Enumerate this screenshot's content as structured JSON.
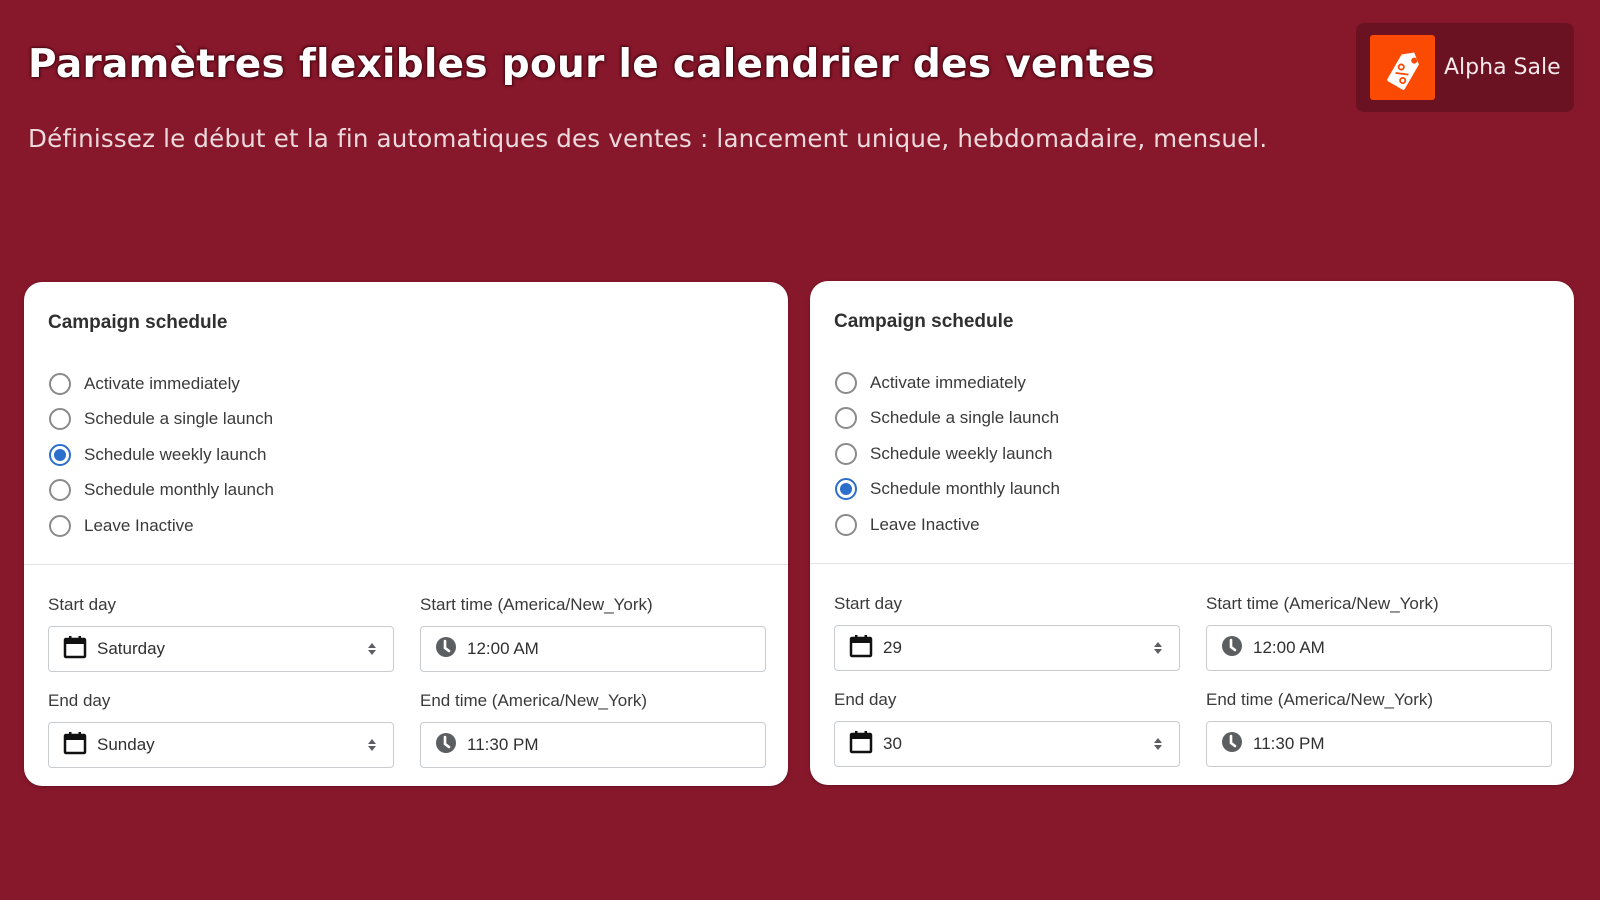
{
  "header": {
    "title": "Paramètres flexibles pour le calendrier des ventes",
    "subtitle": "Définissez le début et la fin automatiques des ventes : lancement unique, hebdomadaire, mensuel."
  },
  "brand": {
    "name": "Alpha Sale",
    "logo_icon": "price-tag-percent-icon",
    "logo_color": "#fb4a03"
  },
  "colors": {
    "background": "#87172b",
    "accent": "#2c6ecb"
  },
  "cards": [
    {
      "title": "Campaign schedule",
      "options": [
        {
          "label": "Activate immediately",
          "checked": false
        },
        {
          "label": "Schedule a single launch",
          "checked": false
        },
        {
          "label": "Schedule weekly launch",
          "checked": true
        },
        {
          "label": "Schedule monthly launch",
          "checked": false
        },
        {
          "label": "Leave Inactive",
          "checked": false
        }
      ],
      "start_day": {
        "label": "Start day",
        "value": "Saturday",
        "icon": "calendar-icon"
      },
      "end_day": {
        "label": "End day",
        "value": "Sunday",
        "icon": "calendar-icon"
      },
      "start_time": {
        "label": "Start time (America/New_York)",
        "value": "12:00 AM",
        "icon": "clock-icon"
      },
      "end_time": {
        "label": "End time (America/New_York)",
        "value": "11:30 PM",
        "icon": "clock-icon"
      }
    },
    {
      "title": "Campaign schedule",
      "options": [
        {
          "label": "Activate immediately",
          "checked": false
        },
        {
          "label": "Schedule a single launch",
          "checked": false
        },
        {
          "label": "Schedule weekly launch",
          "checked": false
        },
        {
          "label": "Schedule monthly launch",
          "checked": true
        },
        {
          "label": "Leave Inactive",
          "checked": false
        }
      ],
      "start_day": {
        "label": "Start day",
        "value": "29",
        "icon": "calendar-icon"
      },
      "end_day": {
        "label": "End day",
        "value": "30",
        "icon": "calendar-icon"
      },
      "start_time": {
        "label": "Start time (America/New_York)",
        "value": "12:00 AM",
        "icon": "clock-icon"
      },
      "end_time": {
        "label": "End time (America/New_York)",
        "value": "11:30 PM",
        "icon": "clock-icon"
      }
    }
  ]
}
